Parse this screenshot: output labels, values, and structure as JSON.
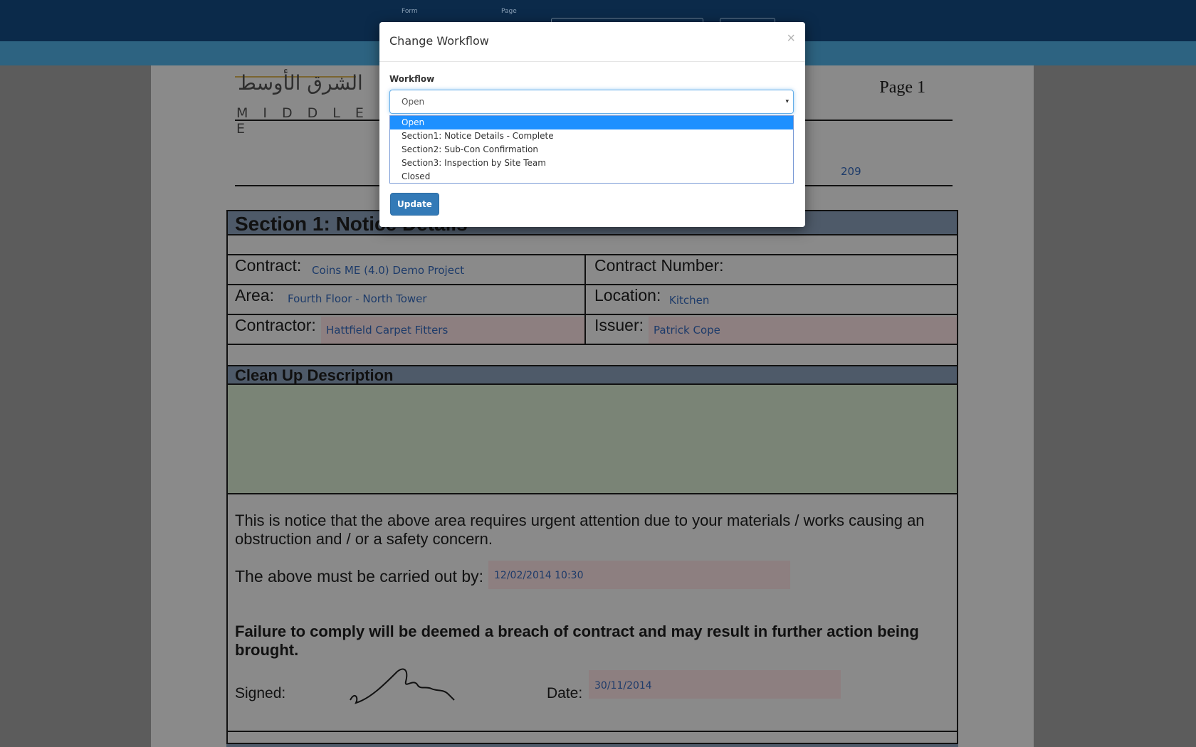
{
  "topbar": {
    "form_label": "Form",
    "page_label": "Page"
  },
  "document": {
    "logo_arabic": "الشرق الأوسط",
    "logo_latin": "MIDDLE E",
    "page_label": "Page 1",
    "reference_number": "209",
    "section1_title": "Section 1: Notice Details",
    "contract_label": "Contract:",
    "contract_value": "Coins ME (4.0) Demo Project",
    "contract_number_label": "Contract Number:",
    "area_label": "Area:",
    "area_value": "Fourth Floor - North Tower",
    "location_label": "Location:",
    "location_value": "Kitchen",
    "contractor_label": "Contractor:",
    "contractor_value": "Hattfield Carpet Fitters",
    "issuer_label": "Issuer:",
    "issuer_value": "Patrick Cope",
    "cleanup_title": "Clean Up Description",
    "notice_text": "This is notice that the above area requires urgent attention due to your materials / works causing an obstruction and / or a safety concern.",
    "carried_out_label": "The above must be carried out by:",
    "carried_out_value": "12/02/2014 10:30",
    "warning_text": "Failure to comply will be deemed a breach of contract and may result in further action being brought.",
    "signed_label": "Signed:",
    "date_label": "Date:",
    "date_value": "30/11/2014"
  },
  "modal": {
    "title": "Change Workflow",
    "close_glyph": "×",
    "field_label": "Workflow",
    "selected_value": "Open",
    "caret_glyph": "▾",
    "options": [
      "Open",
      "Section1: Notice Details - Complete",
      "Section2: Sub-Con Confirmation",
      "Section3: Inspection by Site Team",
      "Closed"
    ],
    "highlighted_option_index": 0,
    "update_label": "Update"
  },
  "colors": {
    "topbar": "#0b2a4a",
    "subbar": "#2d6381",
    "selected_option": "#1e90ff",
    "primary_button": "#337ab7",
    "field_value_text": "#1d3b6a"
  }
}
